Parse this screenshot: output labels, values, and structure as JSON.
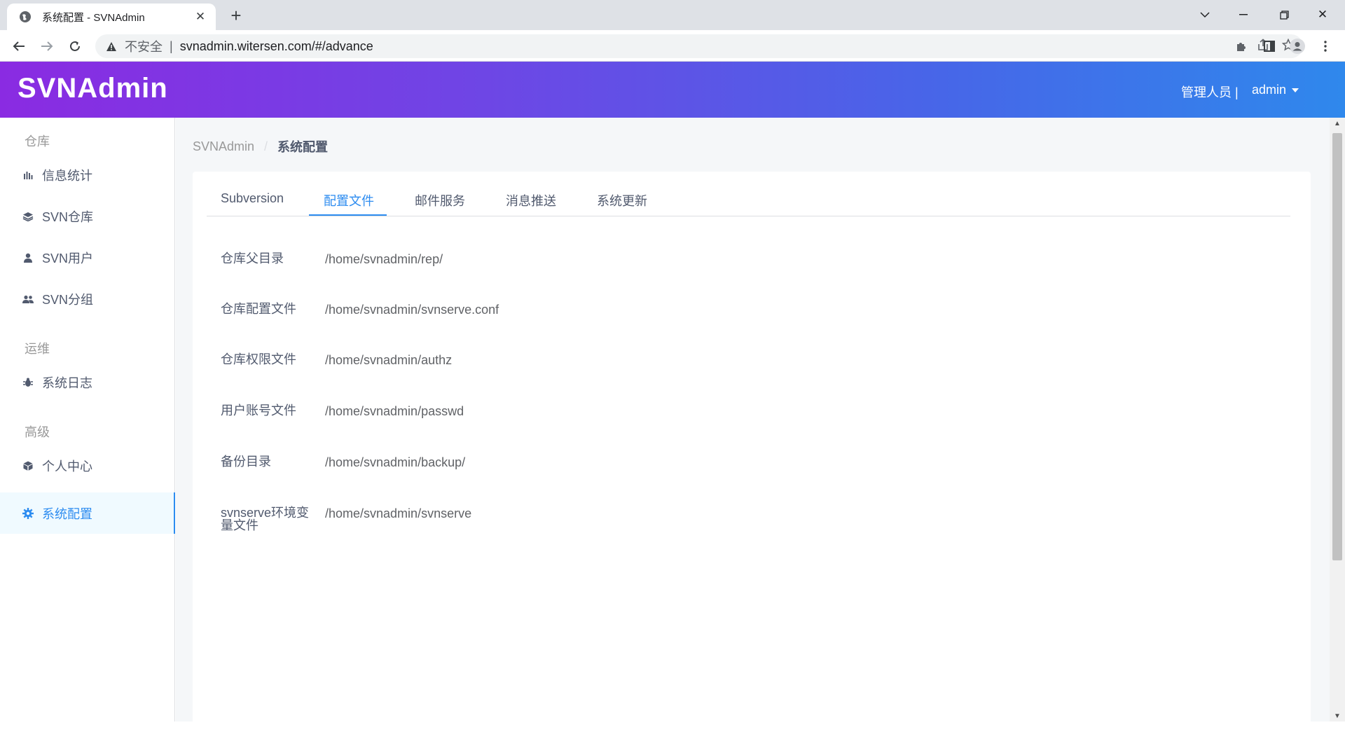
{
  "browser": {
    "tab_title": "系统配置 - SVNAdmin",
    "insecure_label": "不安全",
    "url": "svnadmin.witersen.com/#/advance"
  },
  "header": {
    "logo": "SVNAdmin",
    "role": "管理人员 |",
    "user": "admin"
  },
  "sidebar": {
    "groups": [
      {
        "title": "仓库"
      },
      {
        "title": "运维"
      },
      {
        "title": "高级"
      }
    ],
    "items": [
      {
        "label": "信息统计",
        "icon": "bar-chart-icon"
      },
      {
        "label": "SVN仓库",
        "icon": "layers-icon"
      },
      {
        "label": "SVN用户",
        "icon": "user-icon"
      },
      {
        "label": "SVN分组",
        "icon": "users-icon"
      },
      {
        "label": "系统日志",
        "icon": "bug-icon"
      },
      {
        "label": "个人中心",
        "icon": "cube-icon"
      },
      {
        "label": "系统配置",
        "icon": "gear-icon",
        "active": true
      }
    ]
  },
  "breadcrumb": {
    "root": "SVNAdmin",
    "separator": "/",
    "current": "系统配置"
  },
  "tabs": [
    {
      "label": "Subversion"
    },
    {
      "label": "配置文件",
      "active": true
    },
    {
      "label": "邮件服务"
    },
    {
      "label": "消息推送"
    },
    {
      "label": "系统更新"
    }
  ],
  "config_rows": [
    {
      "label": "仓库父目录",
      "value": "/home/svnadmin/rep/"
    },
    {
      "label": "仓库配置文件",
      "value": "/home/svnadmin/svnserve.conf"
    },
    {
      "label": "仓库权限文件",
      "value": "/home/svnadmin/authz"
    },
    {
      "label": "用户账号文件",
      "value": "/home/svnadmin/passwd"
    },
    {
      "label": "备份目录",
      "value": "/home/svnadmin/backup/"
    },
    {
      "label": "svnserve环境变量文件",
      "value": "/home/svnadmin/svnserve"
    }
  ],
  "colors": {
    "primary": "#2d8cf0",
    "header_gradient_start": "#8a2be2",
    "header_gradient_end": "#2f88ec"
  }
}
